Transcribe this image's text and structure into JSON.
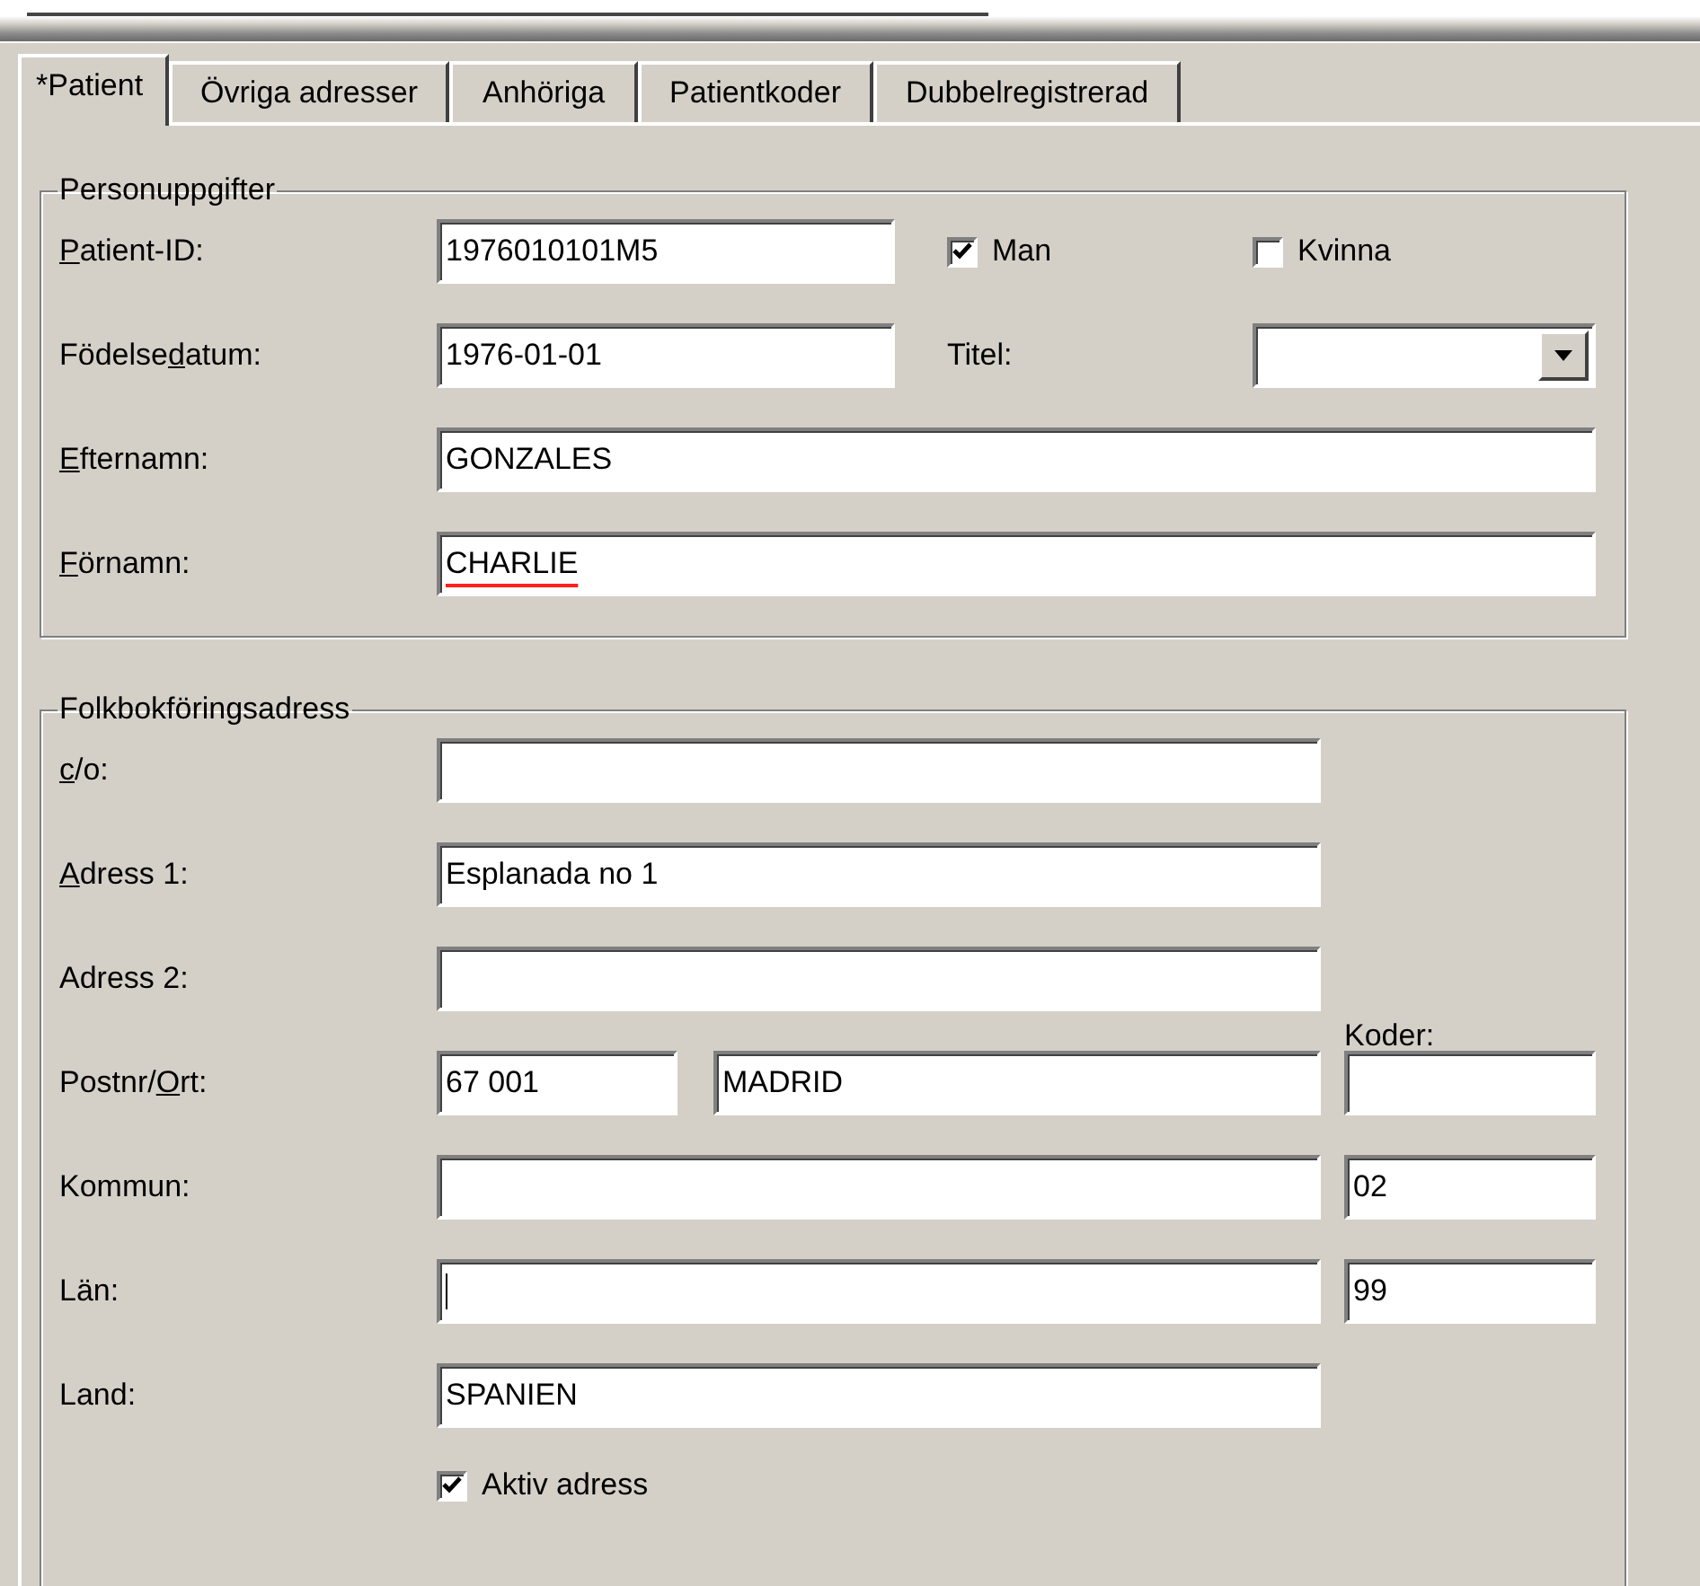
{
  "tabs": [
    {
      "label": "*Patient",
      "selected": true
    },
    {
      "label": "Övriga adresser",
      "selected": false
    },
    {
      "label": "Anhöriga",
      "selected": false
    },
    {
      "label": "Patientkoder",
      "selected": false
    },
    {
      "label": "Dubbelregistrerad",
      "selected": false
    }
  ],
  "personal": {
    "title": "Personuppgifter",
    "patient_id": {
      "label": {
        "key": "P",
        "post": "atient-ID:"
      },
      "value": "1976010101M5"
    },
    "man": {
      "label": "Man",
      "checked": true
    },
    "kvinna": {
      "label": "Kvinna",
      "checked": false
    },
    "birth_date": {
      "label": {
        "pre": "Födelse",
        "key": "d",
        "post": "atum:"
      },
      "value": "1976-01-01"
    },
    "title_field": {
      "label": {
        "pre": "Titel:"
      }
    },
    "last_name": {
      "label": {
        "key": "E",
        "post": "fternamn:"
      },
      "value": "GONZALES"
    },
    "first_name": {
      "label": {
        "key": "F",
        "post": "örnamn:"
      },
      "value": "CHARLIE",
      "spell_error": true
    }
  },
  "address": {
    "title": "Folkbokföringsadress",
    "co": {
      "label": {
        "key": "c",
        "post": "/o:"
      }
    },
    "address1": {
      "label": {
        "key": "A",
        "post": "dress 1:"
      },
      "value": "Esplanada no 1"
    },
    "address2": {
      "label": {
        "pre": "Adress 2:"
      }
    },
    "codes_label": "Koder:",
    "postal": {
      "label": {
        "pre": "Postnr/",
        "key": "O",
        "post": "rt:"
      },
      "zip": "67 001",
      "city": "MADRID"
    },
    "municipality": {
      "label": {
        "pre": "Kommun:"
      },
      "code": "02"
    },
    "county": {
      "label": {
        "pre": "Län:"
      },
      "focused": true,
      "code": "99"
    },
    "country": {
      "label": {
        "pre": "Land:"
      },
      "value": "SPANIEN"
    },
    "active": {
      "label": "Aktiv adress",
      "checked": true
    }
  }
}
